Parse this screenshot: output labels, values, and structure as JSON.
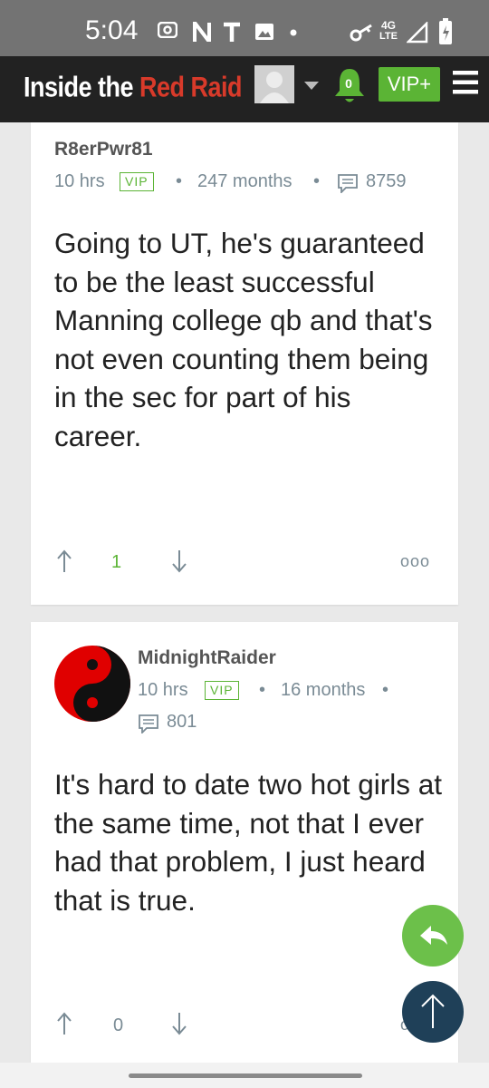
{
  "status_bar": {
    "time": "5:04",
    "network": "4G",
    "network_sub": "LTE",
    "icons": [
      "nfc-icon",
      "n-icon",
      "t-icon",
      "image-icon",
      "dot-icon",
      "key-icon",
      "signal-icon",
      "battery-icon"
    ]
  },
  "header": {
    "site_title_part1": "Inside the ",
    "site_title_part2": "Red Raiders",
    "notification_count": "0",
    "vip_button": "VIP+",
    "colors": {
      "bar": "#222222",
      "accent": "#5bb435",
      "brand_red": "#d83a2a"
    }
  },
  "posts": [
    {
      "username": "R8erPwr81",
      "time": "10 hrs",
      "badge": "VIP",
      "membership": "247 months",
      "post_count": "8759",
      "body": "Going to UT, he's guaranteed to be the least successful Manning college qb and that's not even counting them being in the sec for part of his career.",
      "upvotes": "1"
    },
    {
      "username": "MidnightRaider",
      "time": "10 hrs",
      "badge": "VIP",
      "membership": "16 months",
      "post_count": "801",
      "body": "It's hard to date two hot girls at the same time, not that I ever had that problem, I just heard that is true.",
      "upvotes": "0"
    }
  ],
  "actions": {
    "more": "ooo",
    "reply_fab_color": "#6cc04a",
    "top_fab_color": "#1f4058"
  }
}
